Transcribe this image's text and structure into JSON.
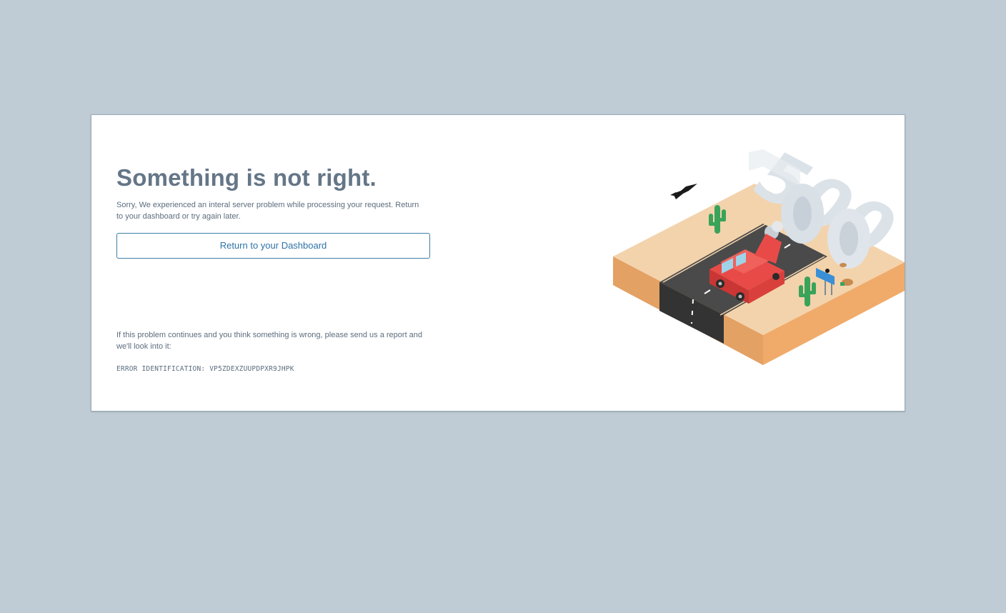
{
  "error_page": {
    "title": "Something is not right.",
    "description": "Sorry, We experienced an interal server problem while processing your request. Return to your dashboard or try again later.",
    "dashboard_button_label": "Return to your Dashboard",
    "report_text": "If this problem continues and you think something is wrong, please send us a report and we'll look into it:",
    "error_identification": "ERROR IDENTIFICATION: VP5ZDEXZUUPDPXR9JHPK"
  },
  "illustration": {
    "big_text": "500",
    "icons": [
      "crow-icon",
      "cactus-icon",
      "car-icon",
      "road-sign-icon"
    ],
    "colors": {
      "page_background": "#bfccd5",
      "title": "#647687",
      "button_border": "#3f7fa6",
      "button_text": "#2d73a8",
      "sand": "#f3d3ac",
      "sand_side": "#e3a164",
      "road": "#3f3f3f",
      "car": "#e84b47",
      "cactus": "#3aa35a"
    }
  }
}
